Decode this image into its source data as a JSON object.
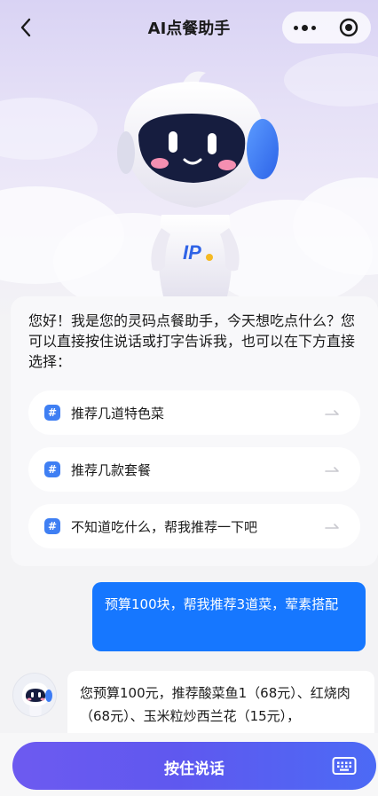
{
  "navbar": {
    "title": "AI点餐助手",
    "back_icon": "chevron-left-icon",
    "more_icon": "more-dots-icon",
    "close_icon": "target-close-icon"
  },
  "mascot": {
    "icon": "robot-mascot-icon",
    "badge_text": "IP"
  },
  "greeting": {
    "text": "您好！我是您的灵码点餐助手，今天想吃点什么？您可以直接按住说话或打字告诉我，也可以在下方直接选择：",
    "options": [
      {
        "label": "推荐几道特色菜",
        "badge": "#"
      },
      {
        "label": "推荐几款套餐",
        "badge": "#"
      },
      {
        "label": "不知道吃什么，帮我推荐一下吧",
        "badge": "#"
      }
    ]
  },
  "conversation": {
    "user_message": "预算100块，帮我推荐3道菜，荤素搭配",
    "bot_message": "您预算100元，推荐酸菜鱼1（68元）、红烧肉（68元）、玉米粒炒西兰花（15元），"
  },
  "bottom_bar": {
    "talk_label": "按住说话",
    "keyboard_icon": "keyboard-icon"
  },
  "colors": {
    "accent": "#1677ff",
    "hash_badge": "#3f7ff3",
    "talk_gradient_start": "#6d5af0",
    "talk_gradient_end": "#4c6af5"
  }
}
